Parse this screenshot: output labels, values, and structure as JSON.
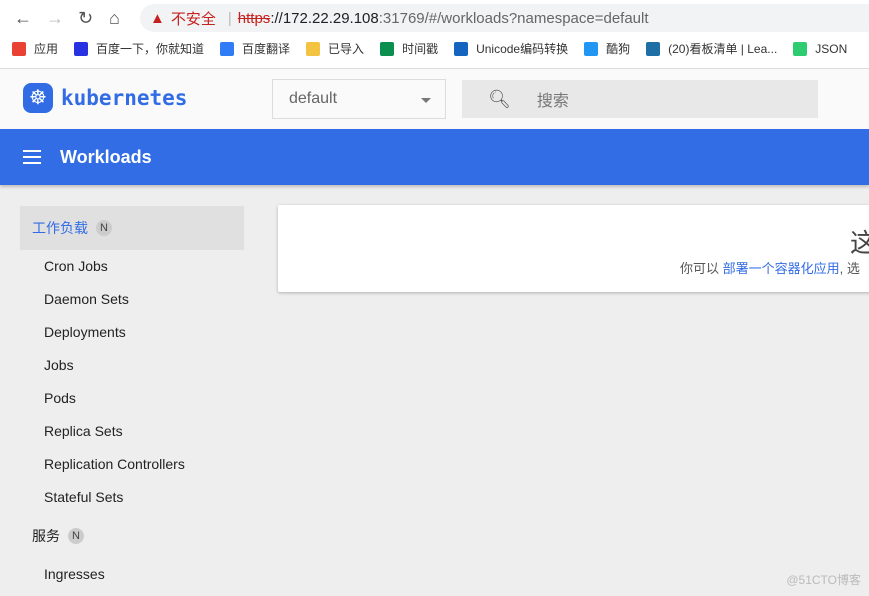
{
  "browser": {
    "warning": "不安全",
    "url_scheme": "https",
    "url_host": "://172.22.29.108",
    "url_rest": ":31769/#/workloads?namespace=default",
    "bookmarks": [
      {
        "label": "应用",
        "icon": "apps-grid-icon",
        "color": "#e94235"
      },
      {
        "label": "百度一下，你就知道",
        "icon": "baidu-paw-icon",
        "color": "#2932e1"
      },
      {
        "label": "百度翻译",
        "icon": "translate-icon",
        "color": "#2f7cf6"
      },
      {
        "label": "已导入",
        "icon": "folder-icon",
        "color": "#f5c342"
      },
      {
        "label": "时间戳",
        "icon": "timestamp-icon",
        "color": "#0a8f4e"
      },
      {
        "label": "Unicode编码转换",
        "icon": "unicode-icon",
        "color": "#1565c0"
      },
      {
        "label": "酷狗",
        "icon": "kugou-icon",
        "color": "#2196f3"
      },
      {
        "label": "(20)看板清单 | Lea...",
        "icon": "leankit-icon",
        "color": "#1d6fa5"
      },
      {
        "label": "JSON",
        "icon": "json-icon",
        "color": "#2ecc71"
      }
    ]
  },
  "header": {
    "logo_text": "kubernetes",
    "namespace": "default",
    "search_placeholder": "搜索"
  },
  "toolbar": {
    "title": "Workloads"
  },
  "sidebar": {
    "sections": [
      {
        "label": "工作负载",
        "badge": "N",
        "items": [
          "Cron Jobs",
          "Daemon Sets",
          "Deployments",
          "Jobs",
          "Pods",
          "Replica Sets",
          "Replication Controllers",
          "Stateful Sets"
        ]
      },
      {
        "label": "服务",
        "badge": "N",
        "items": [
          "Ingresses"
        ]
      }
    ]
  },
  "main": {
    "heading": "这",
    "text_prefix": "你可以 ",
    "link": "部署一个容器化应用",
    "text_suffix": ", 选"
  },
  "watermark": "@51CTO博客",
  "colors": {
    "accent": "#326ce5",
    "toolbar": "#326de6"
  }
}
